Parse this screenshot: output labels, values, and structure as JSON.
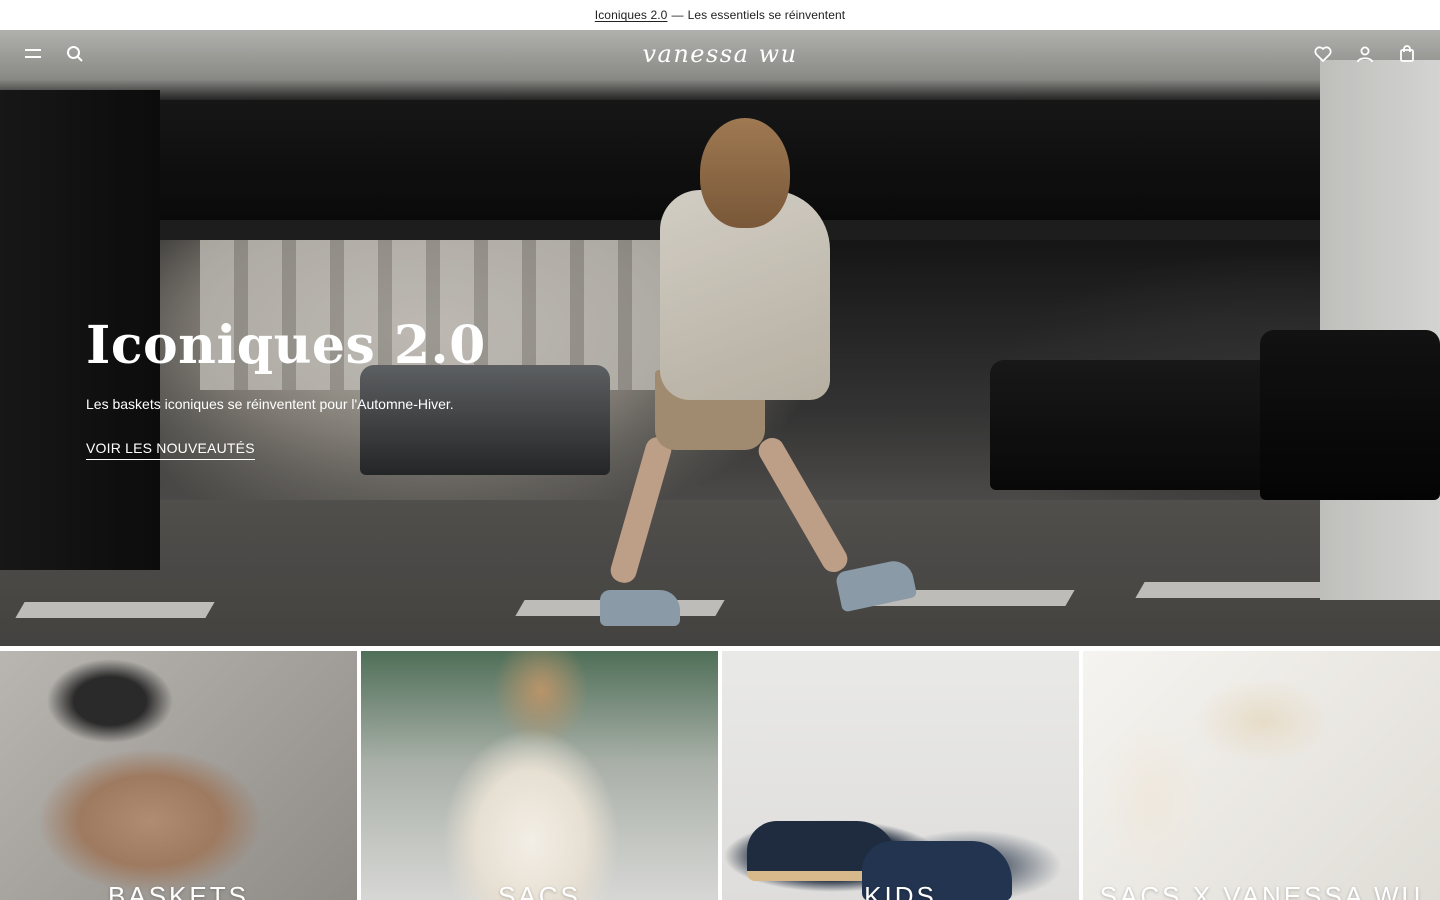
{
  "announcement": {
    "link_text": "Iconiques 2.0",
    "separator": "—",
    "text": "Les essentiels se réinventent"
  },
  "header": {
    "logo": "vanessa wu",
    "icons": {
      "menu": "menu-icon",
      "search": "search-icon",
      "wishlist": "heart-icon",
      "account": "user-icon",
      "cart": "bag-icon"
    }
  },
  "hero": {
    "title": "Iconiques 2.0",
    "subtitle": "Les baskets iconiques se réinventent pour l'Automne-Hiver.",
    "cta": "VOIR LES NOUVEAUTÉS"
  },
  "categories": [
    {
      "label": "BASKETS"
    },
    {
      "label": "SACS"
    },
    {
      "label": "KIDS"
    },
    {
      "label": "SACS X VANESSA WU"
    }
  ],
  "colors": {
    "text_on_image": "#ffffff",
    "announcement_bg": "#ffffff",
    "announcement_text": "#222222"
  }
}
